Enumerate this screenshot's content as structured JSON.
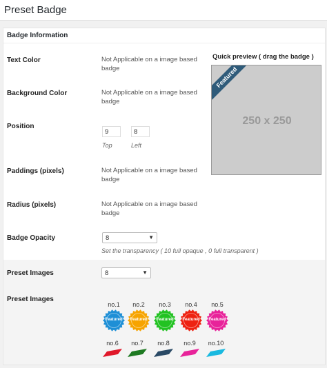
{
  "page": {
    "title": "Preset Badge"
  },
  "panel": {
    "title": "Badge Information"
  },
  "rows": {
    "text_color": {
      "label": "Text Color",
      "value": "Not Applicable on a image based badge"
    },
    "background_color": {
      "label": "Background Color",
      "value": "Not Applicable on a image based badge"
    },
    "position": {
      "label": "Position",
      "top_value": "9",
      "left_value": "8",
      "top_label": "Top",
      "left_label": "Left"
    },
    "paddings": {
      "label": "Paddings (pixels)",
      "value": "Not Applicable on a image based badge"
    },
    "radius": {
      "label": "Radius (pixels)",
      "value": "Not Applicable on a image based badge"
    },
    "opacity": {
      "label": "Badge Opacity",
      "selected": "8",
      "hint": "Set the transparency ( 10 full opaque , 0 full transparent )"
    },
    "preset_select": {
      "label": "Preset Images",
      "selected": "8"
    },
    "preset_images": {
      "label": "Preset Images"
    }
  },
  "preview": {
    "label": "Quick preview ( drag the badge )",
    "size_text": "250 x 250",
    "badge_text": "Featured",
    "badge_color": "#2f5b7a"
  },
  "presets": {
    "seal_text": "Featured",
    "ribbon_text": "Featured",
    "seals": [
      {
        "num": "no.1",
        "color": "#1e8fd6"
      },
      {
        "num": "no.2",
        "color": "#f7a400"
      },
      {
        "num": "no.3",
        "color": "#22c222"
      },
      {
        "num": "no.4",
        "color": "#ee2211"
      },
      {
        "num": "no.5",
        "color": "#e8239a"
      }
    ],
    "ribbons": [
      {
        "num": "no.6",
        "color": "#e0182a"
      },
      {
        "num": "no.7",
        "color": "#1e7a22"
      },
      {
        "num": "no.8",
        "color": "#2a4a66"
      },
      {
        "num": "no.9",
        "color": "#e8239a"
      },
      {
        "num": "no.10",
        "color": "#19b9e0"
      }
    ]
  }
}
